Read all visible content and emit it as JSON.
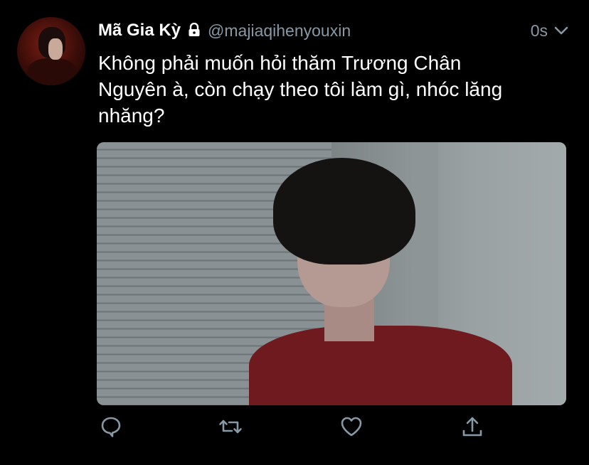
{
  "tweet": {
    "display_name": "Mã Gia Kỳ",
    "handle": "@majiaqihenyouxin",
    "timestamp": "0s",
    "text": "Không phải muốn hỏi thăm Trương Chân\nNguyên à, còn chạy theo tôi làm gì, nhóc lăng\nnhăng?"
  },
  "icons": {
    "lock": "lock-icon",
    "menu": "chevron-down-icon",
    "reply": "reply-icon",
    "retweet": "retweet-icon",
    "like": "heart-icon",
    "share": "share-icon"
  },
  "colors": {
    "background": "#000000",
    "text_primary": "#ffffff",
    "text_secondary": "#8899a6"
  }
}
